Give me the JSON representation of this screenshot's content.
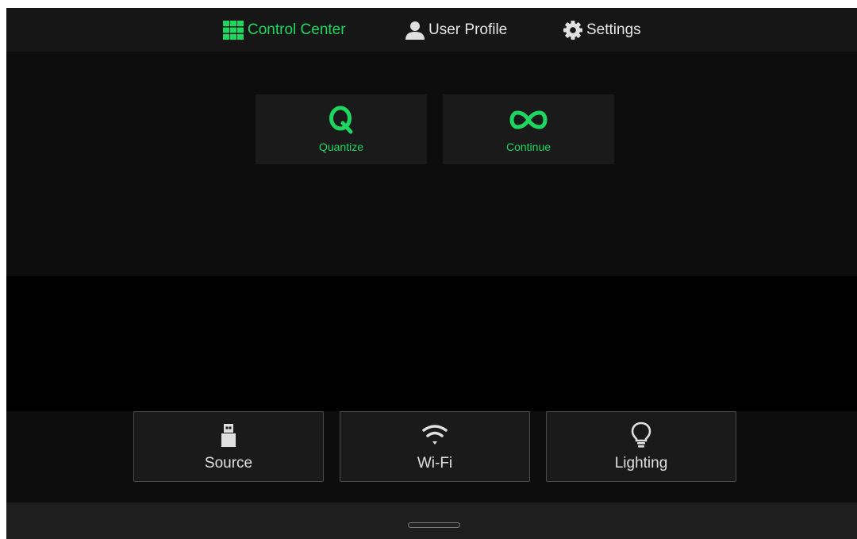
{
  "nav": {
    "tabs": [
      {
        "label": "Control Center",
        "icon": "grid-icon",
        "active": true
      },
      {
        "label": "User Profile",
        "icon": "user-icon",
        "active": false
      },
      {
        "label": "Settings",
        "icon": "gear-icon",
        "active": false
      }
    ]
  },
  "actions": [
    {
      "label": "Quantize",
      "icon": "letter-q-icon"
    },
    {
      "label": "Continue",
      "icon": "infinity-icon"
    }
  ],
  "quick_settings": [
    {
      "label": "Source",
      "icon": "usb-icon"
    },
    {
      "label": "Wi-Fi",
      "icon": "wifi-icon"
    },
    {
      "label": "Lighting",
      "icon": "lightbulb-icon"
    }
  ],
  "colors": {
    "accent": "#1ed760",
    "background": "#000000",
    "panel": "#0d0d0d",
    "tile": "#1a1a1a",
    "text": "#e0e0e0"
  }
}
